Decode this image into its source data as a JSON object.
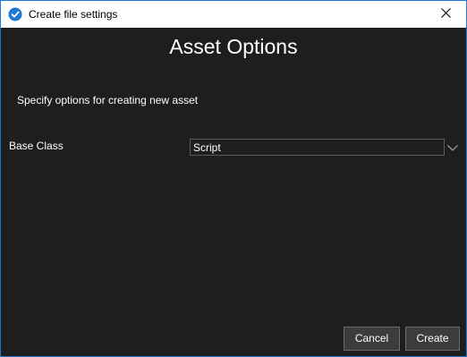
{
  "window": {
    "title": "Create file settings",
    "app_icon": "app-logo-icon",
    "close_icon": "close-icon"
  },
  "content": {
    "heading": "Asset Options",
    "description": "Specify options for creating new asset",
    "base_class": {
      "label": "Base Class",
      "value": "Script",
      "arrow_icon": "chevron-down-icon"
    }
  },
  "buttons": {
    "cancel_label": "Cancel",
    "create_label": "Create"
  },
  "colors": {
    "background": "#1e1e1e",
    "titlebar": "#ffffff",
    "window_border": "#1e78d4",
    "button_bg": "#3c3c3c",
    "text": "#ffffff"
  }
}
